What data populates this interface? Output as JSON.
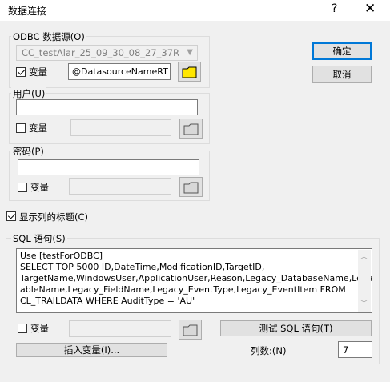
{
  "window": {
    "title": "数据连接",
    "help_glyph": "?",
    "close_glyph": "✕"
  },
  "odbc": {
    "group_label": "ODBC 数据源(O)",
    "datasource": "CC_testAlar_25_09_30_08_27_37R",
    "variable_label": "变量",
    "variable_checked": true,
    "variable_value": "@DatasourceNameRT"
  },
  "user": {
    "group_label": "用户(U)",
    "value": "",
    "variable_label": "变量",
    "variable_checked": false
  },
  "password": {
    "group_label": "密码(P)",
    "value": "",
    "variable_label": "变量",
    "variable_checked": false
  },
  "show_column_titles": {
    "label": "显示列的标题(C)",
    "checked": true
  },
  "sql": {
    "group_label": "SQL 语句(S)",
    "lines": [
      "Use [testForODBC]",
      "SELECT TOP 5000 ID,DateTime,ModificationID,TargetID,",
      "TargetName,WindowsUser,ApplicationUser,Reason,Legacy_DatabaseName,Legacy_T",
      "ableName,Legacy_FieldName,Legacy_EventType,Legacy_EventItem FROM",
      "CL_TRAILDATA WHERE AuditType = 'AU'"
    ],
    "variable_label": "变量",
    "variable_checked": false,
    "test_button": "测试 SQL 语句(T)",
    "insert_button": "插入变量(I)...",
    "columns_label": "列数:(N)",
    "columns_value": "7"
  },
  "buttons": {
    "ok": "确定",
    "cancel": "取消"
  },
  "icons": {
    "folder_active": "#ffe600",
    "folder_inactive": "#d8d8d8"
  }
}
